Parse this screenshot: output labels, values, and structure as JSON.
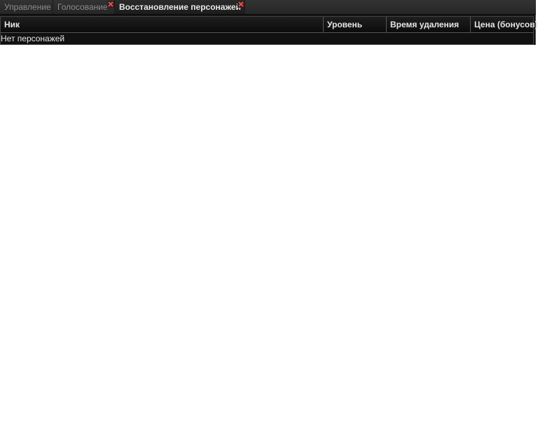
{
  "tabs": [
    {
      "label": "Управление",
      "closable": false,
      "active": false
    },
    {
      "label": "Голосование",
      "closable": true,
      "active": false
    },
    {
      "label": "Восстановление персонажей",
      "closable": true,
      "active": true
    }
  ],
  "table": {
    "columns": [
      "Ник",
      "Уровень",
      "Время удаления",
      "Цена (бонусов)"
    ],
    "empty_text": "Нет персонажей"
  },
  "colors": {
    "close_icon": "#c0392b",
    "panel_bg": "#151515"
  }
}
